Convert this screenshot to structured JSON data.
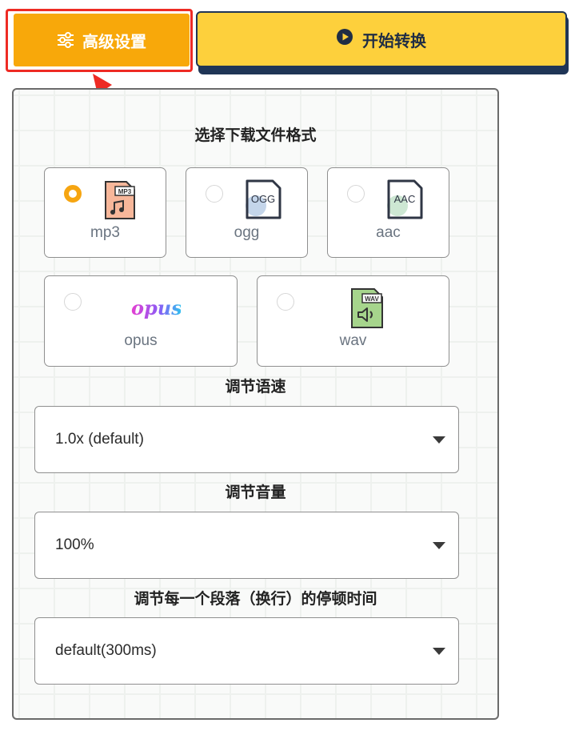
{
  "toolbar": {
    "advanced_label": "高级设置",
    "start_label": "开始转换"
  },
  "colors": {
    "advanced_bg": "#f8a80a",
    "start_bg": "#fdd03c",
    "highlight": "#ee2b24",
    "radio_selected": "#f6a511"
  },
  "format_section": {
    "title": "选择下载文件格式",
    "selected": "mp3",
    "formats": [
      {
        "label": "mp3",
        "icon": "mp3-file-icon",
        "badge": "MP3"
      },
      {
        "label": "ogg",
        "icon": "ogg-file-icon",
        "badge": "OGG"
      },
      {
        "label": "aac",
        "icon": "aac-file-icon",
        "badge": "AAC"
      },
      {
        "label": "opus",
        "icon": "opus-logo",
        "logo_text": "opus"
      },
      {
        "label": "wav",
        "icon": "wav-file-icon",
        "badge": "WAV"
      }
    ]
  },
  "speed": {
    "title": "调节语速",
    "value": "1.0x (default)"
  },
  "volume": {
    "title": "调节音量",
    "value": "100%"
  },
  "pause": {
    "title": "调节每一个段落（换行）的停顿时间",
    "value": "default(300ms)"
  }
}
